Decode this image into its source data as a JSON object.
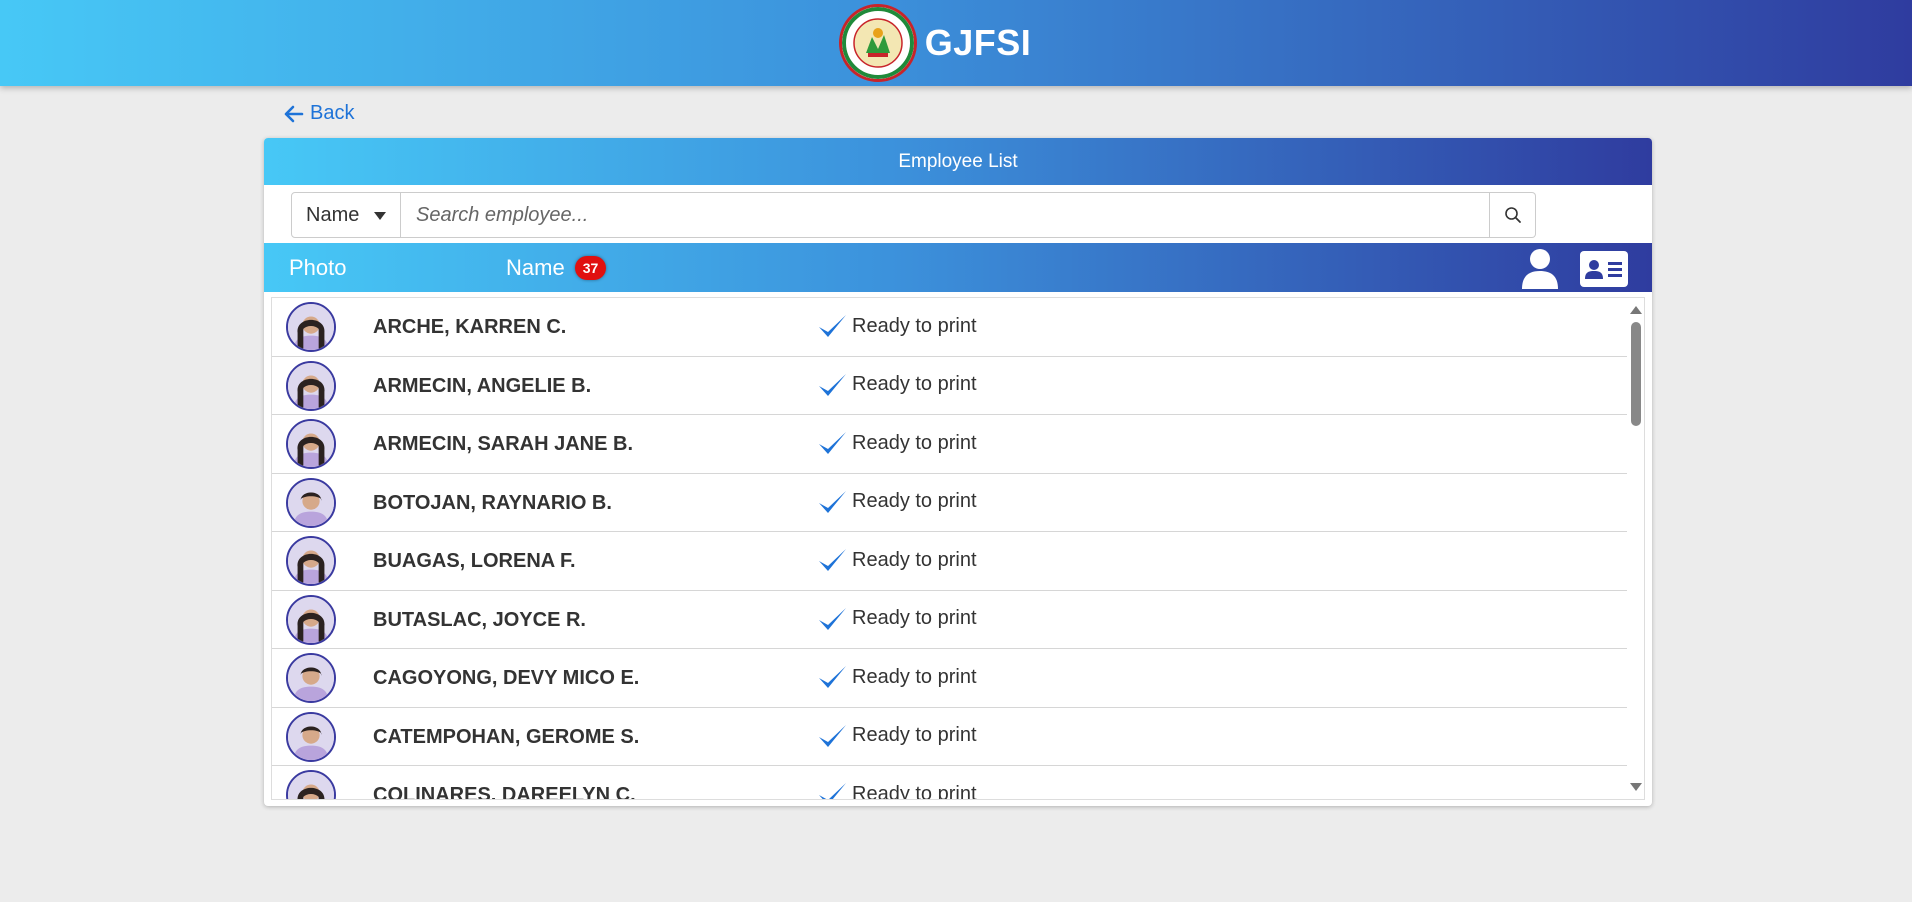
{
  "header": {
    "brand": "GJFSI",
    "logo": "school-seal-logo"
  },
  "nav": {
    "back_label": "Back"
  },
  "card": {
    "title": "Employee List"
  },
  "search": {
    "field_selected": "Name",
    "placeholder": "Search employee..."
  },
  "list_header": {
    "photo_label": "Photo",
    "name_label": "Name",
    "count": "37"
  },
  "employees": [
    {
      "name": "ARCHE, KARREN C.",
      "status": "Ready to print",
      "gender": "female"
    },
    {
      "name": "ARMECIN, ANGELIE B.",
      "status": "Ready to print",
      "gender": "female"
    },
    {
      "name": "ARMECIN, SARAH JANE B.",
      "status": "Ready to print",
      "gender": "female"
    },
    {
      "name": "BOTOJAN, RAYNARIO B.",
      "status": "Ready to print",
      "gender": "male"
    },
    {
      "name": "BUAGAS, LORENA F.",
      "status": "Ready to print",
      "gender": "female"
    },
    {
      "name": "BUTASLAC, JOYCE R.",
      "status": "Ready to print",
      "gender": "female"
    },
    {
      "name": "CAGOYONG, DEVY MICO E.",
      "status": "Ready to print",
      "gender": "male"
    },
    {
      "name": "CATEMPOHAN, GEROME S.",
      "status": "Ready to print",
      "gender": "male"
    },
    {
      "name": "COLINARES, DAREELYN C.",
      "status": "Ready to print",
      "gender": "female"
    }
  ],
  "colors": {
    "gradient_start": "#47c8f6",
    "gradient_end": "#2f3c9f",
    "link": "#1e73d8",
    "check": "#1e73d8",
    "badge": "#e01010"
  }
}
